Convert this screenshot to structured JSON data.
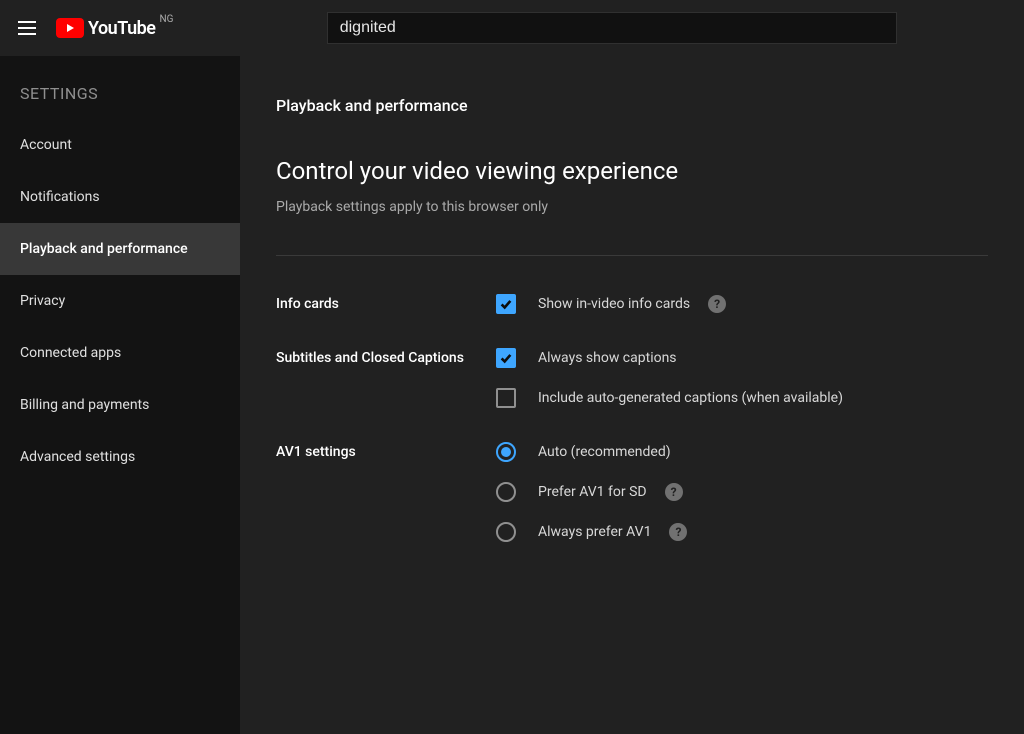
{
  "header": {
    "brand": "YouTube",
    "country_code": "NG",
    "search_value": "dignited"
  },
  "sidebar": {
    "title": "SETTINGS",
    "items": [
      {
        "label": "Account",
        "active": false
      },
      {
        "label": "Notifications",
        "active": false
      },
      {
        "label": "Playback and performance",
        "active": true
      },
      {
        "label": "Privacy",
        "active": false
      },
      {
        "label": "Connected apps",
        "active": false
      },
      {
        "label": "Billing and payments",
        "active": false
      },
      {
        "label": "Advanced settings",
        "active": false
      }
    ]
  },
  "main": {
    "page_title": "Playback and performance",
    "heading": "Control your video viewing experience",
    "subheading": "Playback settings apply to this browser only",
    "sections": {
      "info_cards": {
        "label": "Info cards",
        "option_label": "Show in-video info cards",
        "checked": true,
        "help": "?"
      },
      "subtitles": {
        "label": "Subtitles and Closed Captions",
        "always_show": {
          "label": "Always show captions",
          "checked": true
        },
        "include_auto": {
          "label": "Include auto-generated captions (when available)",
          "checked": false
        }
      },
      "av1": {
        "label": "AV1 settings",
        "options": [
          {
            "label": "Auto (recommended)",
            "selected": true,
            "help": false
          },
          {
            "label": "Prefer AV1 for SD",
            "selected": false,
            "help": true
          },
          {
            "label": "Always prefer AV1",
            "selected": false,
            "help": true
          }
        ]
      }
    }
  }
}
